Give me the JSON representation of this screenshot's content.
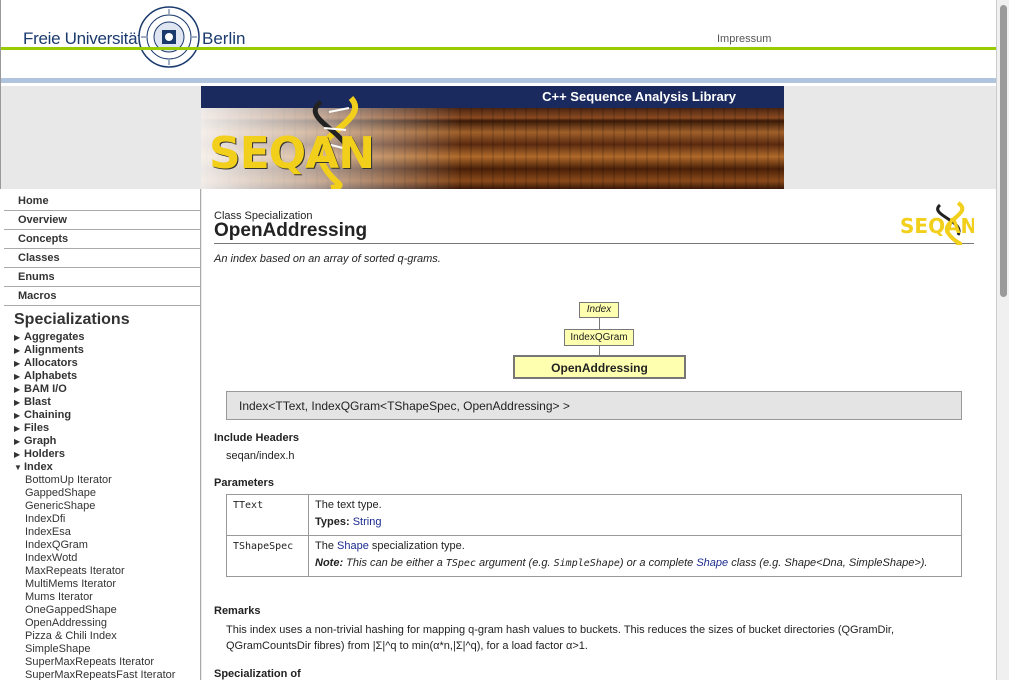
{
  "header": {
    "org_left": "Freie Universität",
    "org_right": "Berlin",
    "seal_text": "VERITAS JUSTITIA LIBERTAS",
    "impressum": "Impressum"
  },
  "banner": {
    "title": "C++ Sequence Analysis Library",
    "logo": "SEQAN"
  },
  "sidebar": {
    "nav": [
      "Home",
      "Overview",
      "Concepts",
      "Classes",
      "Enums",
      "Macros"
    ],
    "section_title": "Specializations",
    "groups_before": [
      "Aggregates",
      "Alignments",
      "Allocators",
      "Alphabets",
      "BAM I/O",
      "Blast",
      "Chaining",
      "Files",
      "Graph",
      "Holders"
    ],
    "open_group": "Index",
    "index_items": [
      "BottomUp Iterator",
      "GappedShape",
      "GenericShape",
      "IndexDfi",
      "IndexEsa",
      "IndexQGram",
      "IndexWotd",
      "MaxRepeats Iterator",
      "MultiMems Iterator",
      "Mums Iterator",
      "OneGappedShape",
      "OpenAddressing",
      "Pizza & Chili Index",
      "SimpleShape",
      "SuperMaxRepeats Iterator",
      "SuperMaxRepeatsFast Iterator"
    ]
  },
  "main": {
    "crumb": "Class Specialization",
    "title": "OpenAddressing",
    "logo": "SEQAN",
    "description": "An index based on an array of sorted q-grams.",
    "hierarchy": {
      "root": "Index",
      "mid": "IndexQGram",
      "leaf": "OpenAddressing"
    },
    "signature": "Index<TText, IndexQGram<TShapeSpec, OpenAddressing> >",
    "include_heading": "Include Headers",
    "include_file": "seqan/index.h",
    "params_heading": "Parameters",
    "params": {
      "p1_name": "TText",
      "p1_desc": "The text type.",
      "p1_types_label": "Types:",
      "p1_types_value": "String",
      "p2_name": "TShapeSpec",
      "p2_desc_pre": "The",
      "p2_desc_link": "Shape",
      "p2_desc_post": "specialization type.",
      "p2_note_label": "Note:",
      "p2_note_1": "This can be either a",
      "p2_note_code1": "TSpec",
      "p2_note_2": "argument (e.g.",
      "p2_note_code2": "SimpleShape",
      "p2_note_3": ") or a complete",
      "p2_note_link": "Shape",
      "p2_note_4": "class (e.g. Shape<Dna, SimpleShape>)."
    },
    "remarks_heading": "Remarks",
    "remarks": "This index uses a non-trivial hashing for mapping q-gram hash values to buckets. This reduces the sizes of bucket directories (QGramDir, QGramCountsDir fibres) from |Σ|^q to min(α*n,|Σ|^q), for a load factor α>1.",
    "specof_heading": "Specialization of"
  },
  "colors": {
    "navy": "#1a2a5e",
    "accent_green": "#99cc00",
    "logo_yellow": "#f2cf1a",
    "box_yellow": "#ffffb0",
    "link": "#1a2a8e"
  }
}
